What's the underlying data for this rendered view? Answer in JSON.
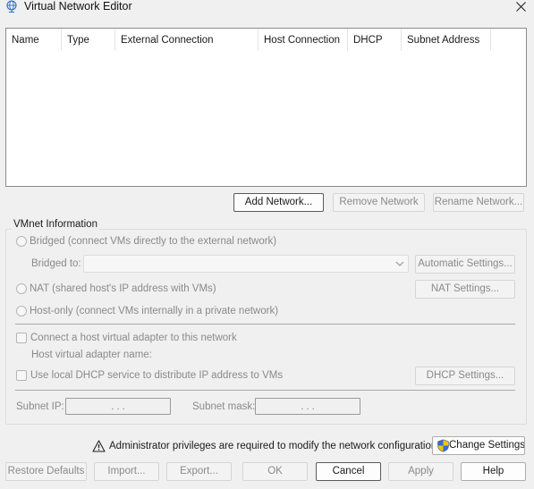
{
  "window": {
    "title": "Virtual Network Editor",
    "close_glyph": "✕"
  },
  "network_list": {
    "columns": [
      "Name",
      "Type",
      "External Connection",
      "Host Connection",
      "DHCP",
      "Subnet Address"
    ],
    "rows": []
  },
  "list_buttons": {
    "add": "Add Network...",
    "remove": "Remove Network",
    "rename": "Rename Network..."
  },
  "vmnet_info": {
    "title": "VMnet Information",
    "bridged_label": "Bridged (connect VMs directly to the external network)",
    "bridged_to_label": "Bridged to:",
    "bridged_to_value": "",
    "automatic_settings": "Automatic Settings...",
    "nat_label": "NAT (shared host's IP address with VMs)",
    "nat_settings": "NAT Settings...",
    "hostonly_label": "Host-only (connect VMs internally in a private network)",
    "connect_adapter_label": "Connect a host virtual adapter to this network",
    "adapter_name_label": "Host virtual adapter name:",
    "dhcp_label": "Use local DHCP service to distribute IP address to VMs",
    "dhcp_settings": "DHCP Settings...",
    "subnet_ip_label": "Subnet IP:",
    "subnet_mask_label": "Subnet mask:",
    "subnet_ip_value": ". . .",
    "subnet_mask_value": ". . ."
  },
  "admin": {
    "message": "Administrator privileges are required to modify the network configuration.",
    "change_settings": "Change Settings"
  },
  "footer": {
    "restore_defaults": "Restore Defaults",
    "import": "Import...",
    "export": "Export...",
    "ok": "OK",
    "cancel": "Cancel",
    "apply": "Apply",
    "help": "Help"
  },
  "icons": {
    "app": "network-globe-icon",
    "close": "close-icon",
    "warning": "warning-icon",
    "shield": "uac-shield-icon",
    "dropdown": "chevron-down-icon"
  },
  "colors": {
    "background": "#f0f0f0",
    "list_background": "#ffffff",
    "disabled_text": "#8a8a8a",
    "shield_blue": "#2f6fd1",
    "shield_yellow": "#f2c40f"
  }
}
